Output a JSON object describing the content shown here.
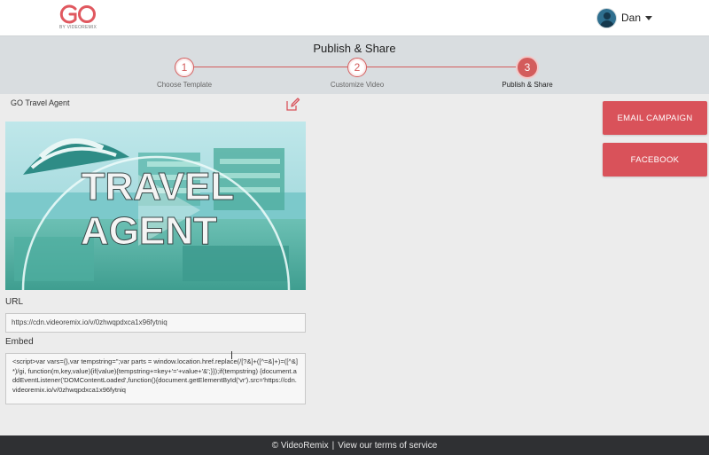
{
  "header": {
    "logo_text": "GO",
    "logo_subtext": "BY VIDEOREMIX",
    "user_name": "Dan"
  },
  "stepper": {
    "title": "Publish & Share",
    "steps": [
      {
        "number": "1",
        "label": "Choose Template"
      },
      {
        "number": "2",
        "label": "Customize Video"
      },
      {
        "number": "3",
        "label": "Publish & Share"
      }
    ],
    "active_step": 3
  },
  "project": {
    "title": "GO Travel Agent",
    "thumbnail_text_line1": "TRAVEL",
    "thumbnail_text_line2": "AGENT"
  },
  "url": {
    "label": "URL",
    "value": "https://cdn.videoremix.io/v/0zhwqpdxca1x96fytniq"
  },
  "embed": {
    "label": "Embed",
    "code": "<script>var vars={},var tempstring='';var parts = window.location.href.replace(/[?&]+([^=&]+)=([^&]*)/gi, function(m,key,value){if(value){tempstring+=key+'='+value+'&';}});if(tempstring) {document.addEventListener('DOMContentLoaded',function(){document.getElementById('vr').src='https://cdn.videoremix.io/v/0zhwqpdxca1x96fytniq"
  },
  "actions": {
    "email_campaign": "EMAIL CAMPAIGN",
    "facebook": "FACEBOOK"
  },
  "footer": {
    "copyright": "© VideoRemix",
    "separator": "|",
    "terms": "View our terms of service"
  },
  "colors": {
    "accent": "#d9525a",
    "logo": "#e0585f",
    "footer_bg": "#2f3033",
    "stepper_bg": "#d9dde0"
  }
}
